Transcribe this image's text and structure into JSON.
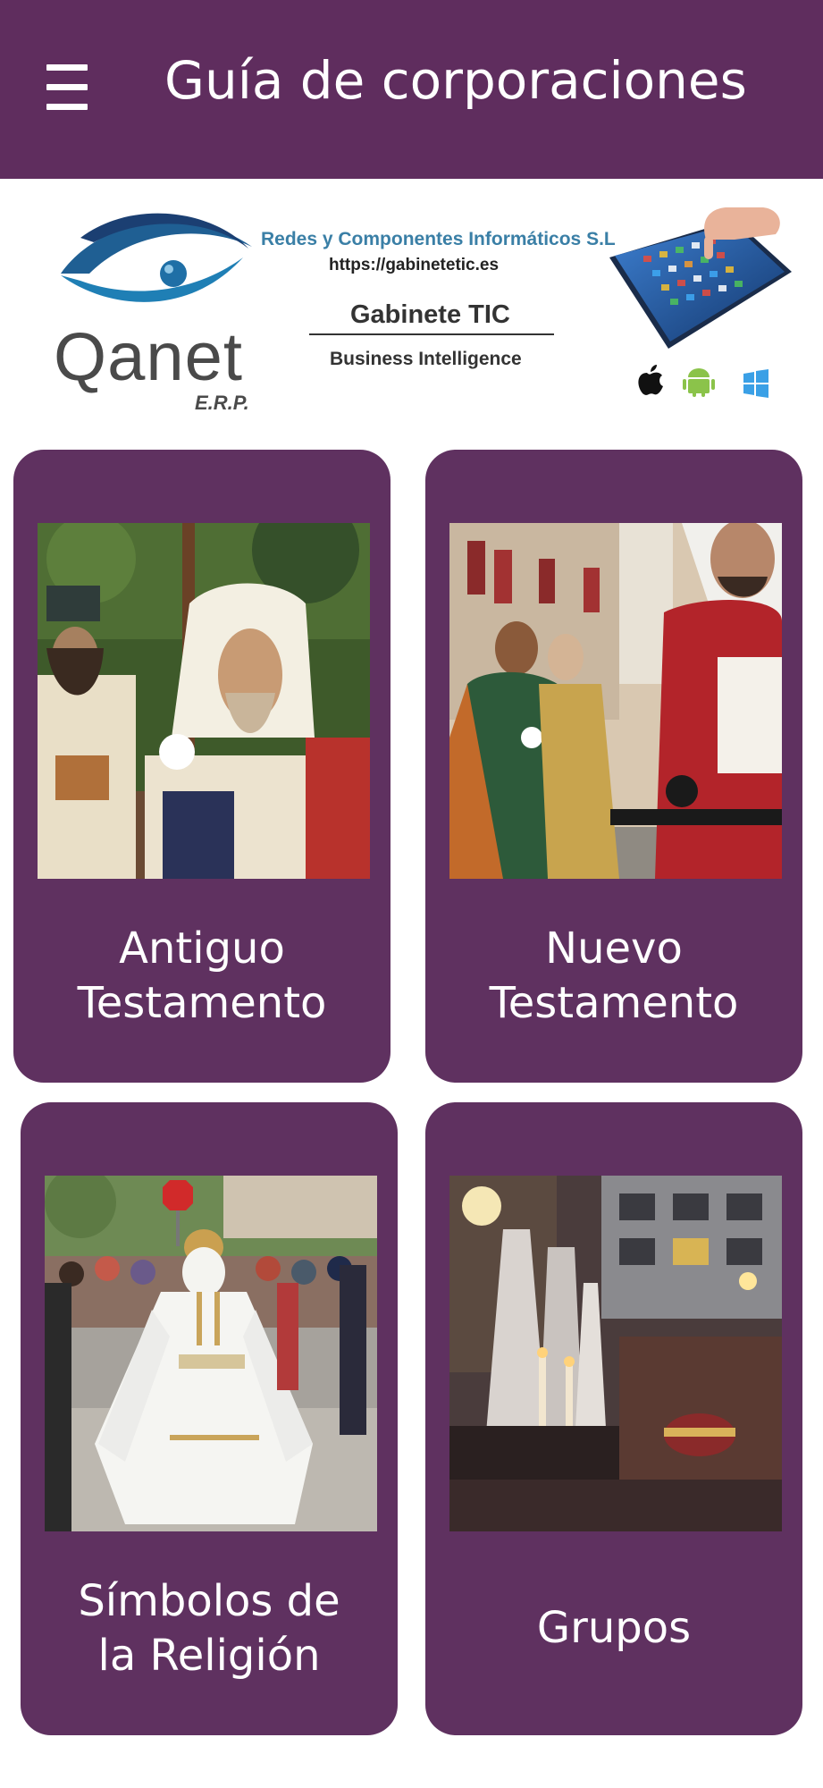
{
  "header": {
    "title": "Guía de corporaciones",
    "menu_icon": "hamburger-menu-icon",
    "background": "#5f2d5e"
  },
  "banner": {
    "logo_word": "Qanet",
    "logo_sub": "E.R.P.",
    "company": "Redes y Componentes Informáticos S.L",
    "url": "https://gabinetetic.es",
    "title": "Gabinete TIC",
    "subtitle": "Business Intelligence",
    "os_icons": [
      "apple-icon",
      "android-icon",
      "windows-icon"
    ]
  },
  "cards": [
    {
      "label_line1": "Antiguo",
      "label_line2": "Testamento",
      "image": "procession-old-testament-photo"
    },
    {
      "label_line1": "Nuevo",
      "label_line2": "Testamento",
      "image": "procession-new-testament-photo"
    },
    {
      "label_line1": "Símbolos de",
      "label_line2": "la Religión",
      "image": "procession-religion-symbols-photo"
    },
    {
      "label_line1": "Grupos",
      "label_line2": "",
      "image": "procession-groups-photo"
    }
  ],
  "colors": {
    "accent": "#5f2d5e",
    "card": "#5f3160",
    "logo_blue": "#1f5f93",
    "company_text": "#3a7fa6"
  }
}
